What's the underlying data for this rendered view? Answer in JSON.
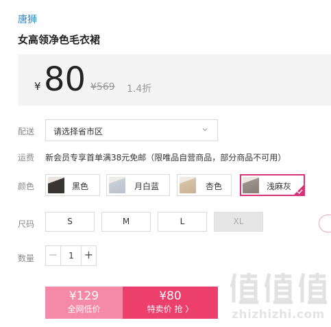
{
  "product": {
    "brand": "唐狮",
    "title": "女高领净色毛衣裙"
  },
  "price": {
    "currency": "¥",
    "current": "80",
    "original": "¥569",
    "discount": "1.4折"
  },
  "delivery": {
    "label": "配送",
    "placeholder": "请选择省市区",
    "icon": "chevron-down-icon"
  },
  "shipping": {
    "label": "运费",
    "text": "新会员专享首单满38元免邮（限唯品自营商品，部分商品不可用）"
  },
  "color": {
    "label": "颜色",
    "options": [
      {
        "name": "黑色",
        "swatch": "#3a3532",
        "selected": false
      },
      {
        "name": "月白蓝",
        "swatch": "#c9cfd8",
        "selected": false
      },
      {
        "name": "杏色",
        "swatch": "#d8c3a8",
        "selected": false
      },
      {
        "name": "浅麻灰",
        "swatch": "#9b938c",
        "selected": true
      }
    ],
    "selected_color": "#d9307a"
  },
  "size": {
    "label": "尺码",
    "options": [
      {
        "name": "S",
        "disabled": false
      },
      {
        "name": "M",
        "disabled": false
      },
      {
        "name": "L",
        "disabled": false
      },
      {
        "name": "XL",
        "disabled": true
      }
    ]
  },
  "quantity": {
    "label": "数量",
    "value": "1",
    "minus": "−",
    "plus": "+"
  },
  "buttons": {
    "all_network": {
      "price": "¥129",
      "label": "全网低价",
      "color": "#f48aa7"
    },
    "special": {
      "price": "¥80",
      "label": "特卖价 抢 〉",
      "color": "#ec3f6b"
    }
  },
  "watermark": {
    "text": "zhizhizhi.com",
    "glyph": "值"
  }
}
